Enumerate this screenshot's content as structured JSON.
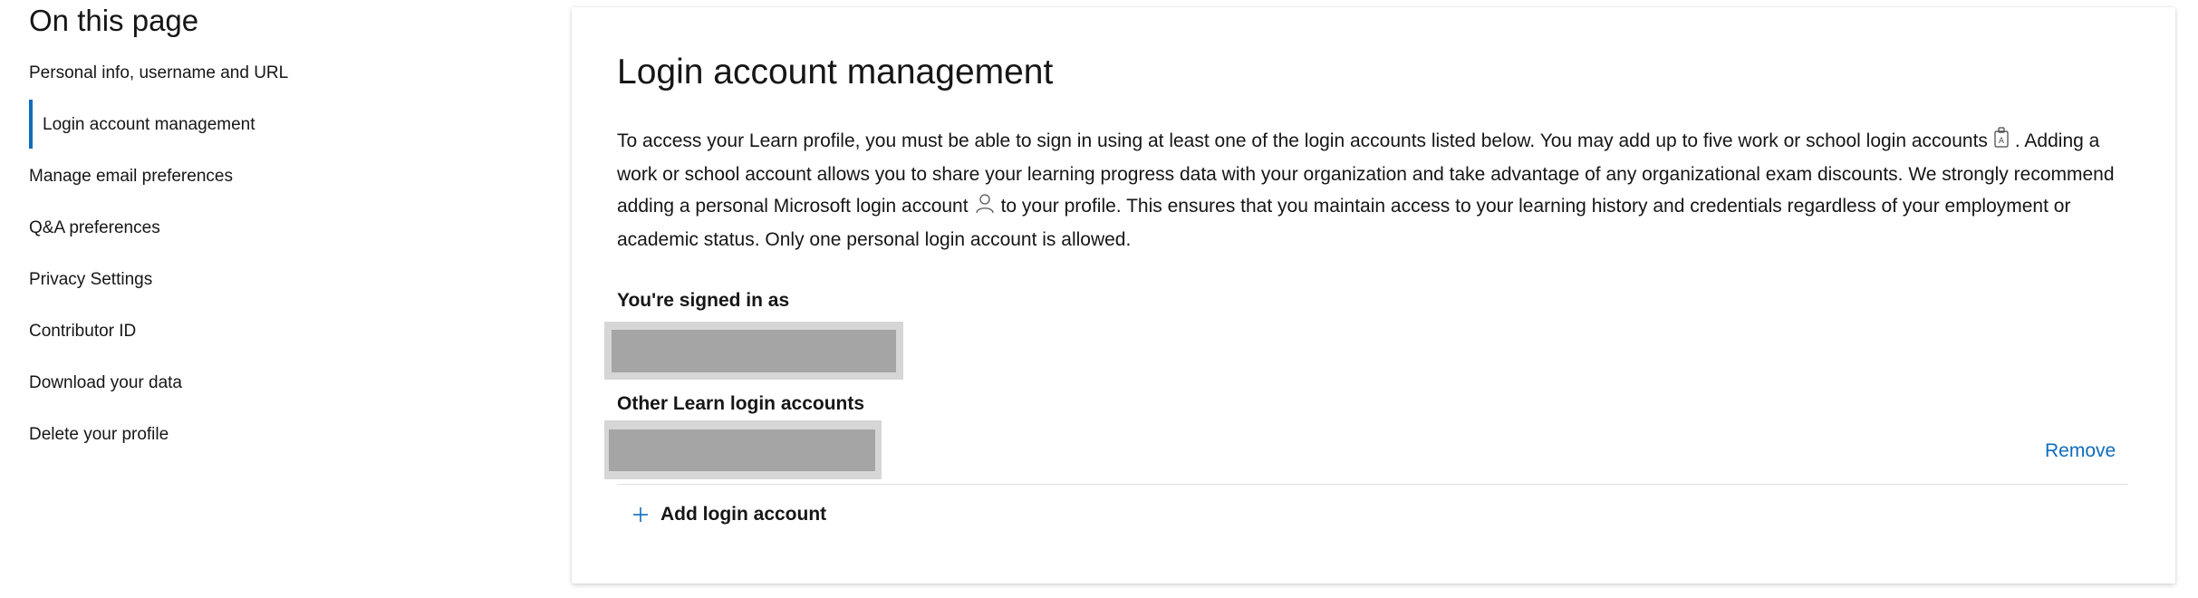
{
  "toc": {
    "title": "On this page",
    "items": [
      {
        "label": "Personal info, username and URL",
        "active": false
      },
      {
        "label": "Login account management",
        "active": true
      },
      {
        "label": "Manage email preferences",
        "active": false
      },
      {
        "label": "Q&A preferences",
        "active": false
      },
      {
        "label": "Privacy Settings",
        "active": false
      },
      {
        "label": "Contributor ID",
        "active": false
      },
      {
        "label": "Download your data",
        "active": false
      },
      {
        "label": "Delete your profile",
        "active": false
      }
    ]
  },
  "card": {
    "title": "Login account management",
    "description": {
      "part1": "To access your Learn profile, you must be able to sign in using at least one of the login accounts listed below. You may add up to five work or school login accounts",
      "part2": ". Adding a work or school account allows you to share your learning progress data with your organization and take advantage of any organizational exam discounts. We strongly recommend adding a personal Microsoft login account",
      "part3": "to your profile. This ensures that you maintain access to your learning history and credentials regardless of your employment or academic status. Only one personal login account is allowed."
    },
    "icons": {
      "work_account": "badge-icon",
      "personal_account": "person-icon",
      "add": "plus-icon"
    },
    "signed_in_label": "You're signed in as",
    "other_accounts_label": "Other Learn login accounts",
    "remove_label": "Remove",
    "add_label": "Add login account"
  },
  "colors": {
    "accent": "#0f6cbd",
    "text": "#161616",
    "redaction": "#a5a5a5"
  }
}
